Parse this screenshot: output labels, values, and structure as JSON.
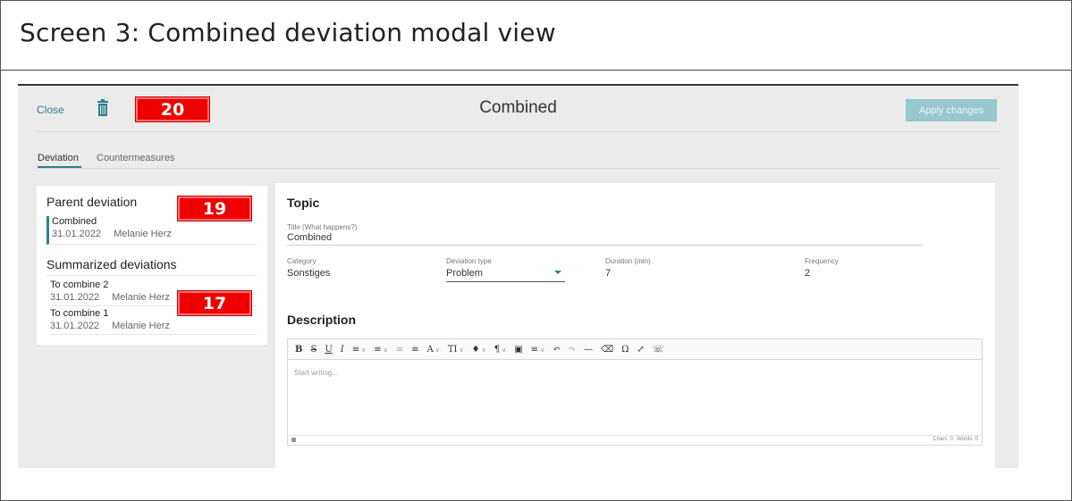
{
  "slide": {
    "title": "Screen 3: Combined deviation modal view"
  },
  "header": {
    "close_label": "Close",
    "trash_icon": "trash-icon",
    "modal_title": "Combined",
    "apply_label": "Apply changes"
  },
  "tabs": [
    {
      "label": "Deviation",
      "active": true
    },
    {
      "label": "Countermeasures",
      "active": false
    }
  ],
  "left_panel": {
    "parent_heading": "Parent deviation",
    "parent": {
      "title": "Combined",
      "date": "31.01.2022",
      "author": "Melanie Herz"
    },
    "summarized_heading": "Summarized deviations",
    "summarized": [
      {
        "title": "To combine 2",
        "date": "31.01.2022",
        "author": "Melanie Herz"
      },
      {
        "title": "To combine 1",
        "date": "31.01.2022",
        "author": "Melanie Herz"
      }
    ]
  },
  "badges": {
    "b20": "20",
    "b19": "19",
    "b17": "17"
  },
  "topic": {
    "heading": "Topic",
    "title_label": "Title (What happens?)",
    "title_value": "Combined",
    "category_label": "Category",
    "category_value": "Sonstiges",
    "type_label": "Deviation type",
    "type_value": "Problem",
    "duration_label": "Duration (min)",
    "duration_value": "7",
    "frequency_label": "Frequency",
    "frequency_value": "2"
  },
  "description": {
    "heading": "Description",
    "placeholder": "Start writing...",
    "chars": "Chars: 0",
    "words": "Words: 0"
  },
  "toolbar": {
    "bold": "B",
    "strike": "S",
    "underline": "U",
    "italic": "I",
    "bullets": "≡",
    "numbered": "≡",
    "outdent": "≡",
    "indent": "≡",
    "font_color": "A",
    "font_size": "TI",
    "highlight": "♦",
    "paragraph": "¶",
    "image": "▣",
    "align": "≡",
    "undo": "↶",
    "redo": "↷",
    "hr": "—",
    "eraser": "⌫",
    "omega": "Ω",
    "fullscreen": "⤢",
    "comment": "☏"
  },
  "colors": {
    "accent": "#2d7f8f",
    "apply_bg": "#98c7ce",
    "badge": "#ee0000"
  }
}
